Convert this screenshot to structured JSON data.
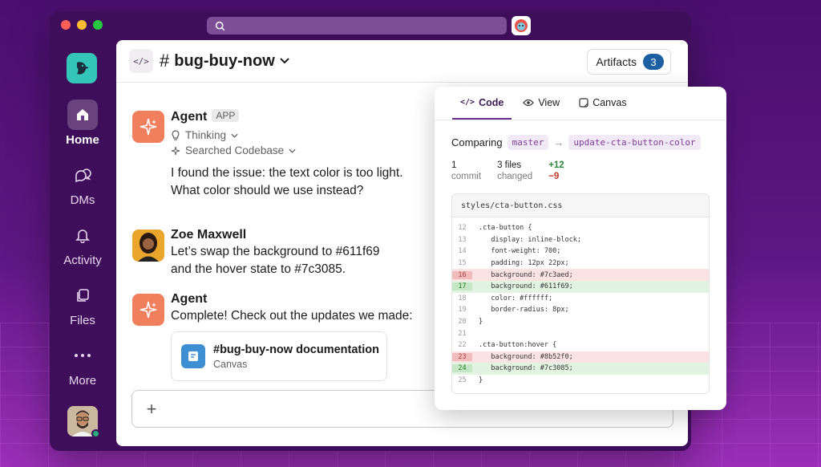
{
  "channel": {
    "name": "bug-buy-now",
    "hash": "#",
    "code_badge": "</>"
  },
  "artifacts": {
    "label": "Artifacts",
    "count": "3"
  },
  "sidebar": {
    "items": [
      {
        "label": "Home"
      },
      {
        "label": "DMs"
      },
      {
        "label": "Activity"
      },
      {
        "label": "Files"
      },
      {
        "label": "More"
      }
    ]
  },
  "messages": [
    {
      "sender": "Agent",
      "tag": "APP",
      "thinking": "Thinking",
      "searched": "Searched Codebase",
      "text1": "I found the issue: the text color is too light.",
      "text2": "What color should we use instead?"
    },
    {
      "sender": "Zoe Maxwell",
      "text1": "Let’s swap the background to #611f69",
      "text2": "and the hover state to #7c3085."
    },
    {
      "sender": "Agent",
      "text1": "Complete! Check out the updates we made:",
      "card_title": "#bug-buy-now documentation",
      "card_sub": "Canvas"
    }
  ],
  "code_panel": {
    "tabs": [
      {
        "label": "Code"
      },
      {
        "label": "View"
      },
      {
        "label": "Canvas"
      }
    ],
    "comparing_label": "Comparing",
    "base_branch": "master",
    "arrow": "→",
    "head_branch": "update-cta-button-color",
    "stats": {
      "commits": "1",
      "commits_label": "commit",
      "files": "3 files",
      "files_label": "changed",
      "additions": "+12",
      "deletions": "−9"
    },
    "file_name": "styles/cta-button.css",
    "lines": [
      {
        "n": "12",
        "code": ".cta-button {",
        "type": ""
      },
      {
        "n": "13",
        "code": "   display: inline-block;",
        "type": ""
      },
      {
        "n": "14",
        "code": "   font-weight: 700;",
        "type": ""
      },
      {
        "n": "15",
        "code": "   padding: 12px 22px;",
        "type": ""
      },
      {
        "n": "16",
        "code": "   background: #7c3aed;",
        "type": "del"
      },
      {
        "n": "17",
        "code": "   background: #611f69;",
        "type": "add"
      },
      {
        "n": "18",
        "code": "   color: #ffffff;",
        "type": ""
      },
      {
        "n": "19",
        "code": "   border-radius: 8px;",
        "type": ""
      },
      {
        "n": "20",
        "code": "}",
        "type": ""
      },
      {
        "n": "21",
        "code": "",
        "type": ""
      },
      {
        "n": "22",
        "code": ".cta-button:hover {",
        "type": ""
      },
      {
        "n": "23",
        "code": "   background: #8b52f0;",
        "type": "del"
      },
      {
        "n": "24",
        "code": "   background: #7c3085;",
        "type": "add"
      },
      {
        "n": "25",
        "code": "}",
        "type": ""
      }
    ]
  },
  "colors": {
    "accent": "#611f69",
    "window": "#3f0e5a",
    "agent": "#f07f5e"
  }
}
